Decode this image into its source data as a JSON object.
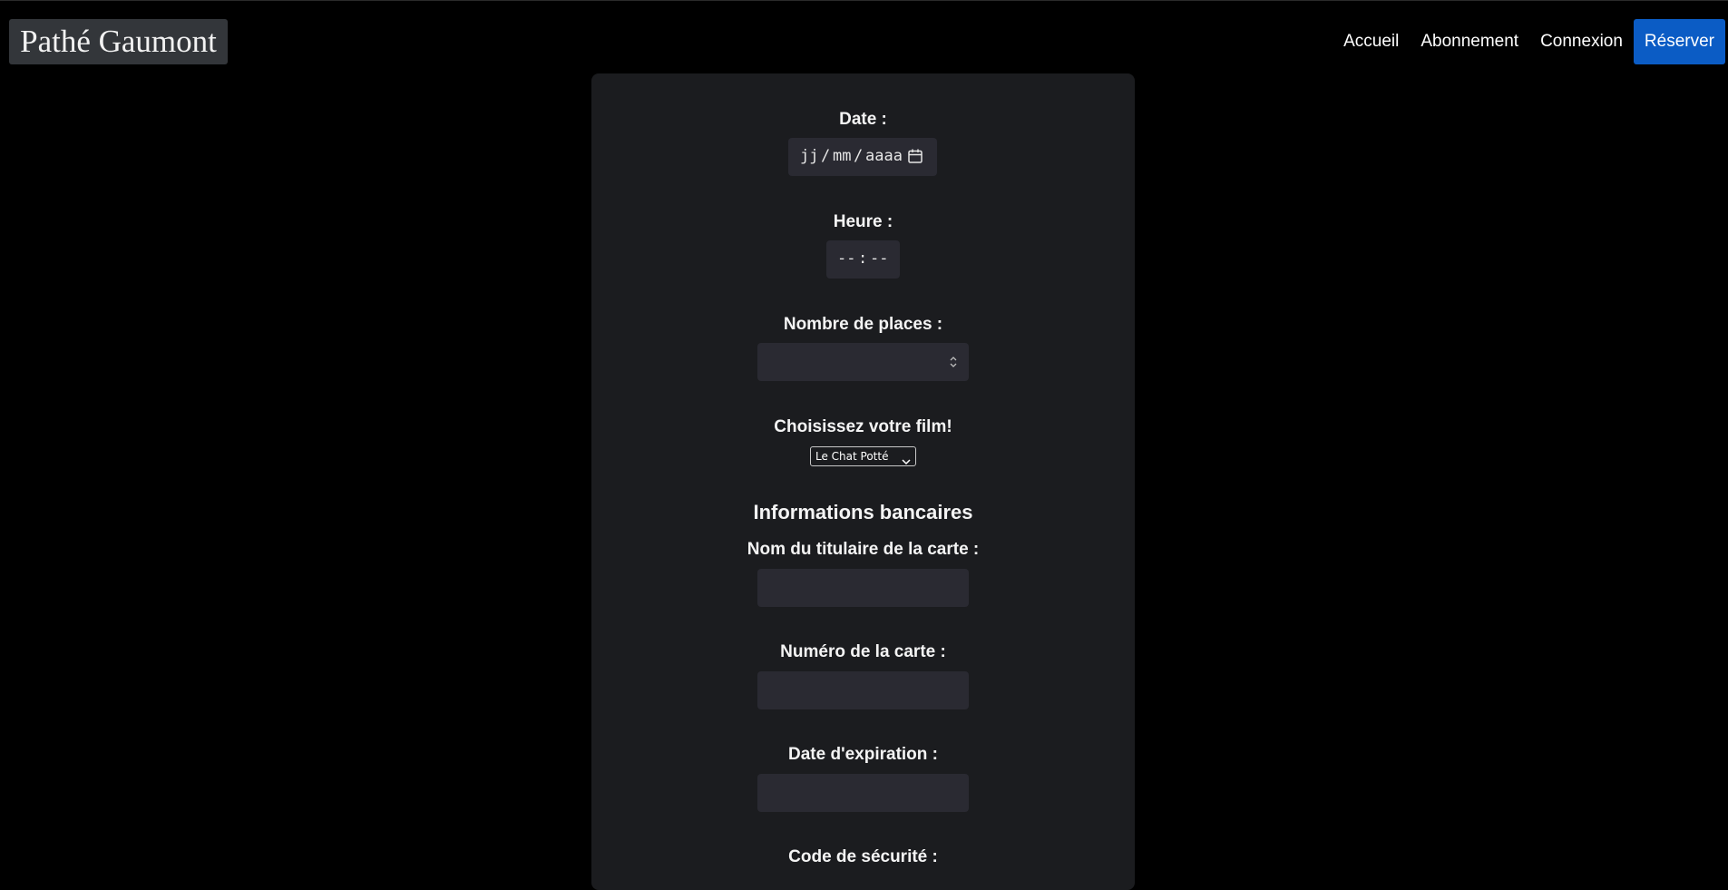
{
  "brand": "Pathé Gaumont",
  "nav": {
    "accueil": "Accueil",
    "abonnement": "Abonnement",
    "connexion": "Connexion",
    "reserver": "Réserver"
  },
  "form": {
    "date_label": "Date :",
    "date_placeholder": {
      "day": "jj",
      "month": "mm",
      "year": "aaaa",
      "sep": "/"
    },
    "heure_label": "Heure :",
    "heure_placeholder": {
      "hours": "--",
      "sep": ":",
      "minutes": "--"
    },
    "places_label": "Nombre de places :",
    "film_label": "Choisissez votre film!",
    "film_selected": "Le Chat Potté",
    "bank_title": "Informations bancaires",
    "titulaire_label": "Nom du titulaire de la carte :",
    "numero_label": "Numéro de la carte :",
    "expiration_label": "Date d'expiration :",
    "securite_label": "Code de sécurité :"
  },
  "icons": {
    "calendar": "calendar-icon",
    "spinner": "spinner-arrows-icon",
    "dropdown": "chevron-down-icon"
  },
  "colors": {
    "background": "#000000",
    "panel": "#1b1c1f",
    "input": "#2a2a32",
    "accent": "#0b5cc5",
    "brand_bg": "#33363a"
  }
}
